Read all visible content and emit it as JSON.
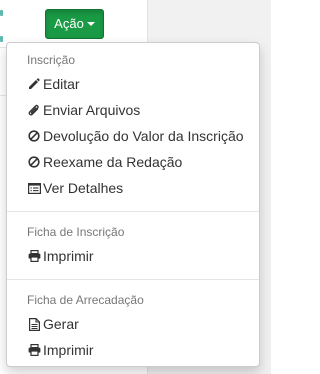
{
  "action_button": {
    "label": "Ação"
  },
  "menu": {
    "sections": [
      {
        "header": "Inscrição",
        "items": [
          {
            "label": "Editar",
            "icon": "pencil-icon"
          },
          {
            "label": "Enviar Arquivos",
            "icon": "paperclip-icon"
          },
          {
            "label": "Devolução do Valor da Inscrição",
            "icon": "ban-icon"
          },
          {
            "label": "Reexame da Redação",
            "icon": "ban-icon"
          },
          {
            "label": "Ver Detalhes",
            "icon": "list-alt-icon"
          }
        ]
      },
      {
        "header": "Ficha de Inscrição",
        "items": [
          {
            "label": "Imprimir",
            "icon": "print-icon"
          }
        ]
      },
      {
        "header": "Ficha de Arrecadação",
        "items": [
          {
            "label": "Gerar",
            "icon": "file-text-icon"
          },
          {
            "label": "Imprimir",
            "icon": "print-icon"
          }
        ]
      }
    ]
  }
}
